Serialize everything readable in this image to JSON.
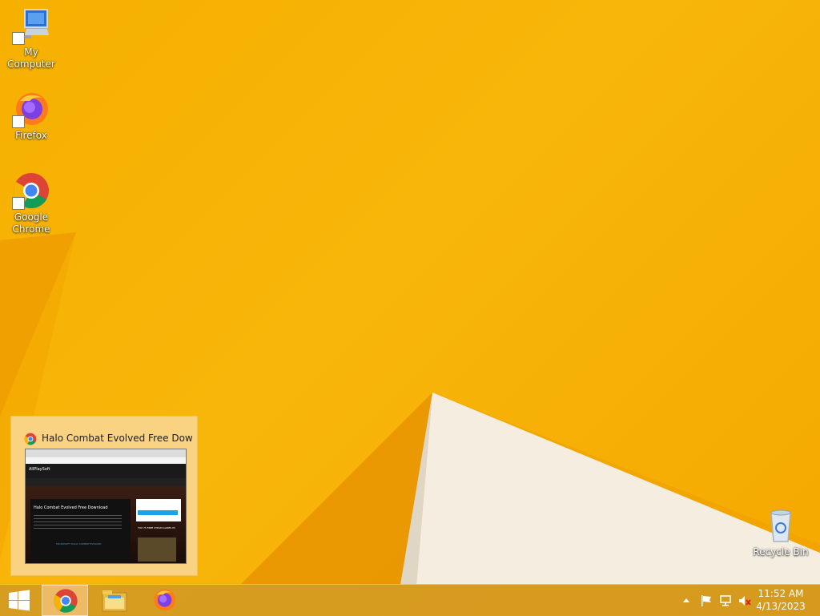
{
  "desktop": {
    "icons": [
      {
        "label": "My Computer",
        "icon": "computer-icon"
      },
      {
        "label": "Firefox",
        "icon": "firefox-icon"
      },
      {
        "label": "Google Chrome",
        "icon": "chrome-icon"
      },
      {
        "label": "Recycle Bin",
        "icon": "recycle-bin-icon"
      }
    ]
  },
  "preview": {
    "title": "Halo Combat Evolved Free Dow...",
    "thumbnail": {
      "site_name": "AllPlaySoft",
      "page_heading": "Halo Combat Evolved Free Download",
      "side_heading": "TOP 75 FREE STEAM GAMES PC",
      "button_text": "MICROSOFT HALO: COMBAT EVOLVED"
    }
  },
  "taskbar": {
    "start": "windows-start-icon",
    "items": [
      {
        "name": "Google Chrome",
        "icon": "chrome-icon",
        "active": true
      },
      {
        "name": "File Explorer",
        "icon": "file-explorer-icon",
        "active": false
      },
      {
        "name": "Firefox",
        "icon": "firefox-icon",
        "active": false
      }
    ],
    "tray": {
      "icons": [
        "show-hidden-icons-chevron",
        "action-center-flag-icon",
        "network-icon",
        "volume-muted-icon"
      ],
      "time": "11:52 AM",
      "date": "4/13/2023"
    }
  },
  "colors": {
    "wallpaper": "#f6b000",
    "wallpaper_dark": "#e88a00",
    "taskbar": "#cd9628"
  }
}
